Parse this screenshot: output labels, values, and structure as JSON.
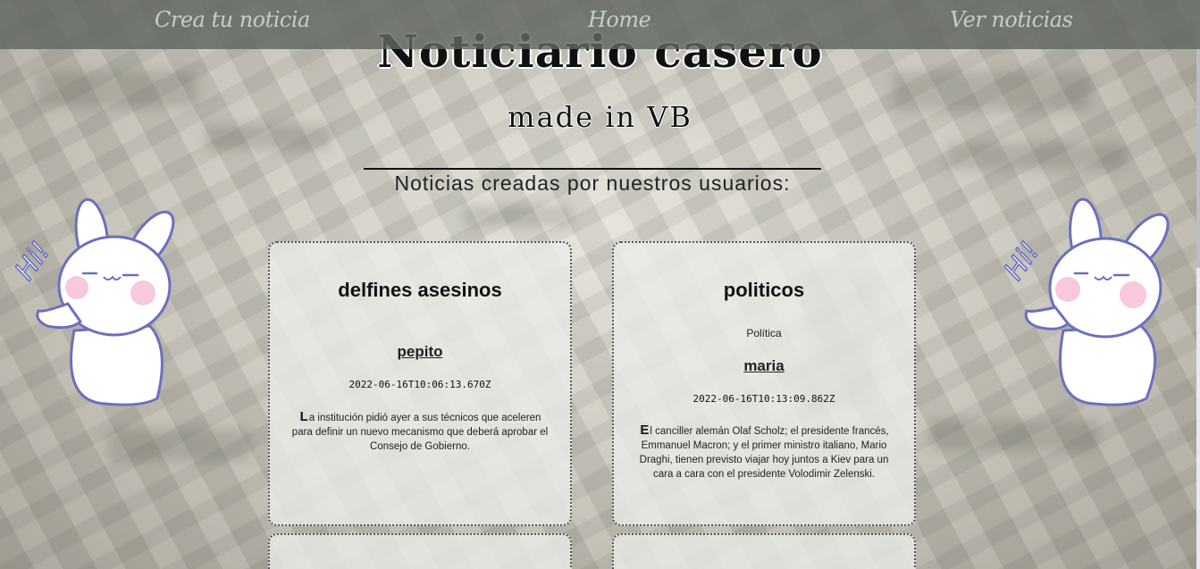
{
  "nav": {
    "create_label": "Crea tu noticia",
    "home_label": "Home",
    "view_label": "Ver noticias"
  },
  "header": {
    "title": "Noticiario casero",
    "subtitle": "made in VB"
  },
  "section": {
    "heading": "Noticias creadas por nuestros usuarios:"
  },
  "decorations": {
    "greeting_left": "Hi!",
    "greeting_right": "Hi!"
  },
  "news": [
    {
      "title": "delfines asesinos",
      "category": "",
      "author": "pepito",
      "date": "2022-06-16T10:06:13.670Z",
      "body_first": "L",
      "body_rest": "a institución pidió ayer a sus técnicos que aceleren para definir un nuevo mecanismo que deberá aprobar el Consejo de Gobierno."
    },
    {
      "title": "politicos",
      "category": "Política",
      "author": "maria",
      "date": "2022-06-16T10:13:09.862Z",
      "body_first": "E",
      "body_rest": "l canciller alemán Olaf Scholz; el presidente francés, Emmanuel Macron; y el primer ministro italiano, Mario Draghi, tienen previsto viajar hoy juntos a Kiev para un cara a cara con el presidente Volodimir Zelenski."
    }
  ],
  "colors": {
    "navbar_bg": "#606660",
    "nav_text": "#c5cec9",
    "bunny_outline": "#6b6fbf",
    "bunny_cheek": "#f8c8dc"
  }
}
